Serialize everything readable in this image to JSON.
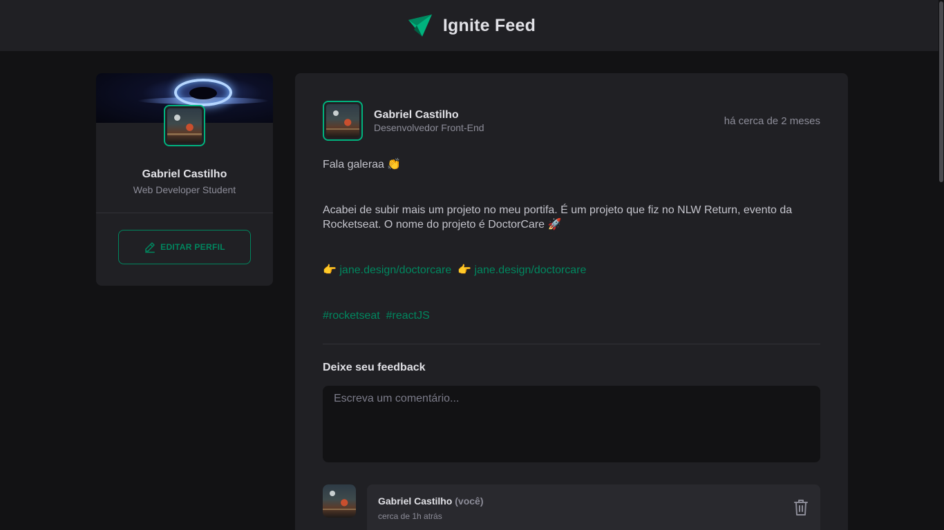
{
  "header": {
    "title": "Ignite Feed",
    "logo_icon": "ignite-logo-icon",
    "accent": "#00b37e"
  },
  "sidebar": {
    "name": "Gabriel Castilho",
    "role": "Web Developer Student",
    "edit_button": "EDITAR PERFIL",
    "edit_icon": "pencil-icon"
  },
  "post": {
    "author": {
      "name": "Gabriel Castilho",
      "role": "Desenvolvedor Front-End"
    },
    "time": "há cerca de 2 meses",
    "content": {
      "greeting": "Fala galeraa",
      "greeting_emoji": "👏",
      "body": "Acabei de subir mais um projeto no meu portifa. É um projeto que fiz no NLW Return, evento da Rocketseat. O nome do projeto é DoctorCare",
      "body_emoji": "🚀",
      "link_emoji": "👉",
      "links": [
        "jane.design/doctorcare",
        "jane.design/doctorcare"
      ],
      "hashtags": [
        "#rocketseat",
        "#reactJS"
      ]
    },
    "feedback": {
      "title": "Deixe seu feedback",
      "placeholder": "Escreva um comentário..."
    }
  },
  "comments": [
    {
      "name": "Gabriel Castilho",
      "you": "(você)",
      "time": "cerca de 1h atrás",
      "delete_icon": "trash-icon"
    }
  ]
}
